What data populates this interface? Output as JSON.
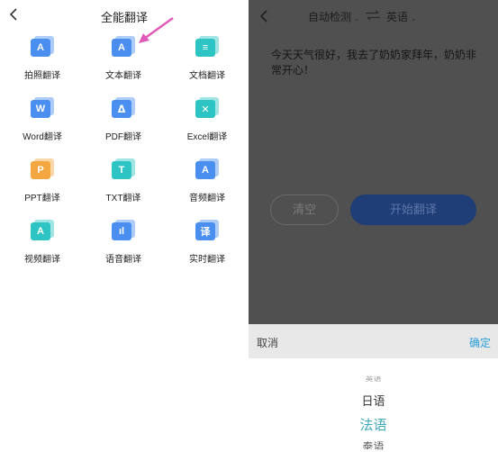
{
  "left": {
    "title": "全能翻译",
    "tools": [
      {
        "label": "拍照翻译",
        "glyph": "A",
        "color": "#4a8ef0"
      },
      {
        "label": "文本翻译",
        "glyph": "A",
        "color": "#4a8ef0"
      },
      {
        "label": "文档翻译",
        "glyph": "≡",
        "color": "#2fc4c4"
      },
      {
        "label": "Word翻译",
        "glyph": "W",
        "color": "#4a8ef0"
      },
      {
        "label": "PDF翻译",
        "glyph": "ᐃ",
        "color": "#4a8ef0"
      },
      {
        "label": "Excel翻译",
        "glyph": "✕",
        "color": "#2fc4c4"
      },
      {
        "label": "PPT翻译",
        "glyph": "P",
        "color": "#f4a640"
      },
      {
        "label": "TXT翻译",
        "glyph": "T",
        "color": "#2fc4c4"
      },
      {
        "label": "音频翻译",
        "glyph": "A",
        "color": "#4a8ef0"
      },
      {
        "label": "视频翻译",
        "glyph": "A",
        "color": "#2fc4c4"
      },
      {
        "label": "语音翻译",
        "glyph": "ıl",
        "color": "#4a8ef0"
      },
      {
        "label": "实时翻译",
        "glyph": "译",
        "color": "#4a8ef0"
      }
    ],
    "arrow_color": "#e05bb8"
  },
  "right": {
    "source_lang": "自动检测",
    "target_lang": "英语",
    "source_text": "今天天气很好，我去了奶奶家拜年，奶奶非常开心！",
    "clear_label": "清空",
    "start_label": "开始翻译",
    "picker": {
      "cancel_label": "取消",
      "confirm_label": "确定",
      "options": [
        "英语",
        "日语",
        "法语",
        "泰语"
      ],
      "selected": "法语"
    }
  }
}
